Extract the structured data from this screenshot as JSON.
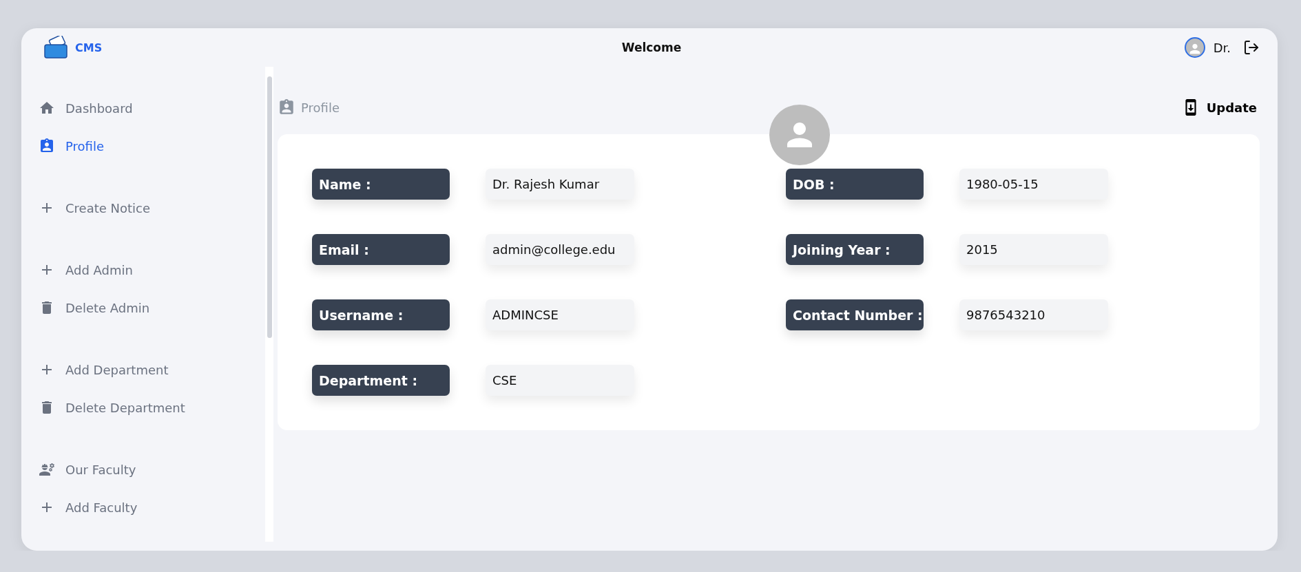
{
  "header": {
    "brand": "CMS",
    "title": "Welcome",
    "user": "Dr."
  },
  "sidebar": {
    "groups": [
      {
        "items": [
          {
            "kind": "home",
            "label": "Dashboard",
            "selected": false
          },
          {
            "kind": "profile",
            "label": "Profile",
            "selected": true
          }
        ]
      },
      {
        "items": [
          {
            "kind": "add",
            "label": "Create Notice",
            "selected": false
          }
        ]
      },
      {
        "items": [
          {
            "kind": "add",
            "label": "Add Admin",
            "selected": false
          },
          {
            "kind": "delete",
            "label": "Delete Admin",
            "selected": false
          }
        ]
      },
      {
        "items": [
          {
            "kind": "add",
            "label": "Add Department",
            "selected": false
          },
          {
            "kind": "delete",
            "label": "Delete Department",
            "selected": false
          }
        ]
      },
      {
        "items": [
          {
            "kind": "faculty",
            "label": "Our Faculty",
            "selected": false
          },
          {
            "kind": "add",
            "label": "Add Faculty",
            "selected": false
          }
        ]
      }
    ]
  },
  "page": {
    "title": "Profile",
    "action": "Update"
  },
  "fields": [
    {
      "label": "Name :",
      "value": "Dr. Rajesh Kumar"
    },
    {
      "label": "DOB :",
      "value": "1980-05-15"
    },
    {
      "label": "Email :",
      "value": "admin@college.edu"
    },
    {
      "label": "Joining Year :",
      "value": "2015"
    },
    {
      "label": "Username :",
      "value": "ADMINCSE"
    },
    {
      "label": "Contact Number :",
      "value": "9876543210"
    },
    {
      "label": "Department :",
      "value": "CSE"
    }
  ]
}
